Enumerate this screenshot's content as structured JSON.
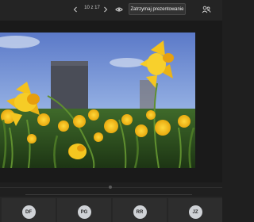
{
  "toolbar": {
    "prev_icon": "chevron-left-icon",
    "slide_counter": "10 z 17",
    "next_icon": "chevron-right-icon",
    "eye_icon": "eye-icon",
    "stop_button_label": "Zatrzymaj prezentowanie",
    "more_icon": "people-icon"
  },
  "slide": {
    "image_subject": "yellow-daffodils-with-stone-monument"
  },
  "participants": [
    {
      "initials": "DF"
    },
    {
      "initials": "PG"
    },
    {
      "initials": "RR"
    },
    {
      "initials": "JZ"
    }
  ],
  "colors": {
    "background": "#1f1f1f",
    "toolbar": "#242424",
    "avatar_bg": "#cfd2d6",
    "flower_yellow": "#f2c31c"
  }
}
